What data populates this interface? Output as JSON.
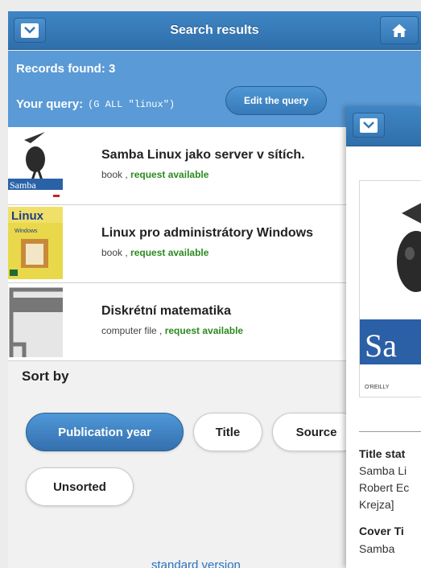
{
  "header": {
    "title": "Search results"
  },
  "query": {
    "records_found": "Records found: 3",
    "label": "Your query:",
    "value": "(G ALL \"linux\")",
    "edit_label": "Edit the query"
  },
  "results": [
    {
      "title": "Samba Linux jako server v sítích.",
      "type": "book , ",
      "availability": "request available",
      "cover_text": "Samba",
      "cover_publisher": "O'REILLY"
    },
    {
      "title": "Linux pro administrátory Windows",
      "type": "book , ",
      "availability": "request available",
      "cover_text": "Linux",
      "cover_sub": "Windows"
    },
    {
      "title": "Diskrétní matematika",
      "type": "computer file , ",
      "availability": "request available"
    }
  ],
  "sort": {
    "title": "Sort by",
    "options": [
      "Publication year",
      "Title",
      "Source",
      "Unsorted"
    ],
    "selected": "Publication year"
  },
  "footer": {
    "standard_link": "standard version"
  },
  "detail": {
    "cover_text": "Sa",
    "cover_publisher": "O'REILLY",
    "title_statement_label": "Title stat",
    "line1": "Samba Li",
    "line2": "Robert Ec",
    "line3": "Krejza]",
    "cover_title_label": "Cover Ti",
    "cover_title_value": "Samba"
  },
  "colors": {
    "header": "#3478b8",
    "query_band": "#5a9ad6",
    "available": "#2a8a1f",
    "link": "#2a72c2"
  },
  "icons": {
    "menu": "chevron-down-icon",
    "home": "home-icon"
  }
}
